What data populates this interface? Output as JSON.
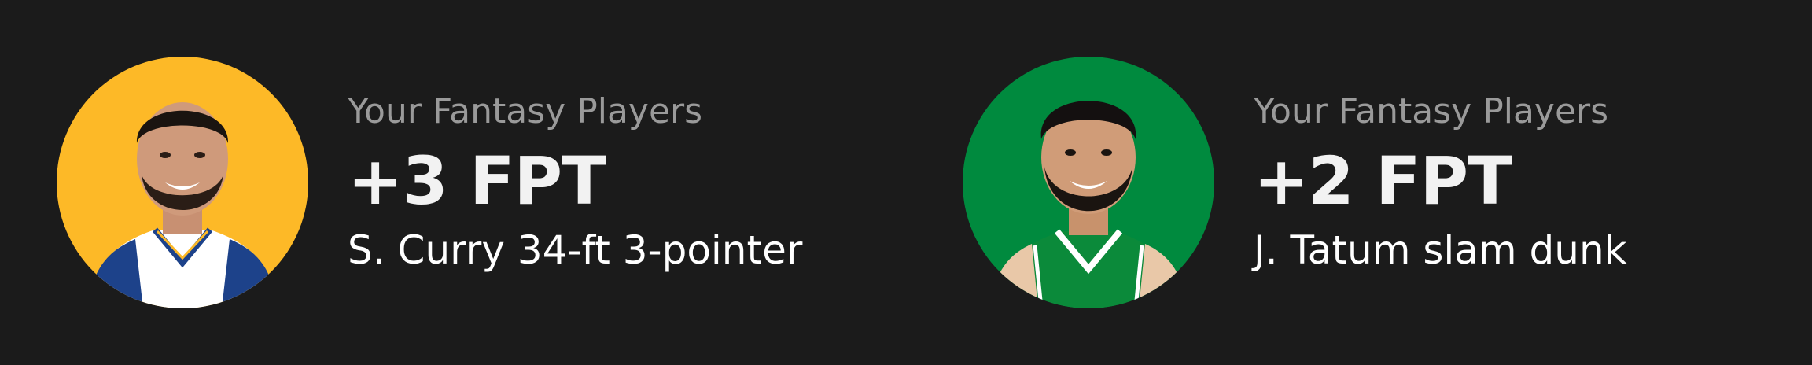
{
  "notifications": [
    {
      "label": "Your Fantasy Players",
      "points": "+3 FPT",
      "description": "S. Curry 34-ft 3-pointer",
      "avatar_icon": "player-headshot-icon",
      "avatar_bg": "#fdb927",
      "jersey_color": "#ffffff",
      "trim_color": "#1d428a"
    },
    {
      "label": "Your Fantasy Players",
      "points": "+2 FPT",
      "description": "J. Tatum slam dunk",
      "avatar_icon": "player-headshot-icon",
      "avatar_bg": "#008a3e",
      "jersey_color": "#0b8a3a",
      "trim_color": "#ffffff"
    }
  ]
}
